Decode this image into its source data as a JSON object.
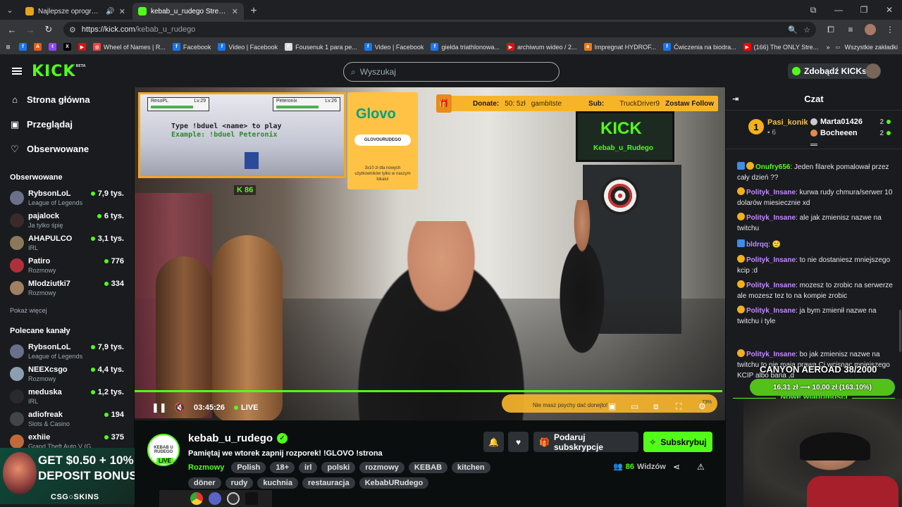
{
  "browser": {
    "tabs": [
      {
        "title": "Najlepsze oprogramowanie",
        "icon": "shield-icon",
        "color": "#e5a41b"
      },
      {
        "title": "kebab_u_rudego Stream - Watch",
        "icon": "kick-icon",
        "color": "#53fc18"
      }
    ],
    "url_host": "https://kick.com",
    "url_path": "/kebab_u_rudego",
    "bookmarks": [
      {
        "label": "Facebook",
        "color": "#1877f2",
        "glyph": "f"
      },
      {
        "label": "Video | Facebook",
        "color": "#1877f2",
        "glyph": "f"
      },
      {
        "label": "Fousenuk 1 para pe...",
        "color": "#ddd",
        "glyph": "F"
      },
      {
        "label": "Video | Facebook",
        "color": "#1877f2",
        "glyph": "f"
      },
      {
        "label": "giełda triathlonowa...",
        "color": "#1877f2",
        "glyph": "f"
      },
      {
        "label": "archiwum wideo / 2...",
        "color": "#d11",
        "glyph": "▶"
      },
      {
        "label": "Impregnat HYDROF...",
        "color": "#e87b17",
        "glyph": "a"
      },
      {
        "label": "Ćwiczenia na biodra...",
        "color": "#1877f2",
        "glyph": "f"
      },
      {
        "label": "(166) The ONLY Stre...",
        "color": "#f00",
        "glyph": "▶"
      }
    ],
    "wheel_bookmark": "Wheel of Names | R...",
    "all_bookmarks": "Wszystkie zakładki"
  },
  "header": {
    "logo": "KICK",
    "logo_sup": "BETA",
    "search_placeholder": "Wyszukaj",
    "get_kicks": "Zdobądź KICKs"
  },
  "sidebar": {
    "nav": [
      "Strona główna",
      "Przeglądaj",
      "Obserwowane"
    ],
    "followed_header": "Obserwowane",
    "followed": [
      {
        "name": "RybsonLoL",
        "category": "League of Legends",
        "viewers": "7,9 tys.",
        "color": "#6a6f8a"
      },
      {
        "name": "pajalock",
        "category": "Ja tylko śpię",
        "viewers": "6 tys.",
        "color": "#3a2a2a"
      },
      {
        "name": "AHAPULCO",
        "category": "IRL",
        "viewers": "3,1 tys.",
        "color": "#8a7a5a"
      },
      {
        "name": "Patiro",
        "category": "Rozmowy",
        "viewers": "776",
        "color": "#b0303a"
      },
      {
        "name": "Mlodziutki7",
        "category": "Rozmowy",
        "viewers": "334",
        "color": "#a08060"
      }
    ],
    "show_more": "Pokaż więcej",
    "recommended_header": "Polecane kanały",
    "recommended": [
      {
        "name": "RybsonLoL",
        "category": "League of Legends",
        "viewers": "7,9 tys.",
        "color": "#6a6f8a"
      },
      {
        "name": "NEEXcsgo",
        "category": "Rozmowy",
        "viewers": "4,4 tys.",
        "color": "#8aa0b0"
      },
      {
        "name": "meduska",
        "category": "IRL",
        "viewers": "1,2 tys.",
        "color": "#2a2a2a"
      },
      {
        "name": "adiofreak",
        "category": "Slots & Casino",
        "viewers": "194",
        "color": "#444"
      },
      {
        "name": "exhiie",
        "category": "Grand Theft Auto V (G...",
        "viewers": "375",
        "color": "#c06a3a"
      }
    ],
    "ad": {
      "line1": "GET $0.50 + 10%",
      "line2": "DEPOSIT BONUS",
      "brand": "CSG○SKINS"
    }
  },
  "video": {
    "game_p1": "ResoPL",
    "game_p1_lv": "Lv.29",
    "game_p2": "Peteronix",
    "game_p2_lv": "Lv.26",
    "game_line1": "Type !bduel <name> to play",
    "game_line2": "Example: !bduel Peteronix",
    "k_count": "86",
    "glovo": "Glovo",
    "glovo_code": "GLOVOURUDEGO",
    "glovo_promo": "3x10 zł dla nowych użytkowników tylko w naszym lokalu!",
    "donate_label": "Donate:",
    "donate_value": "50: 5zł",
    "donate_user": "gambitste",
    "sub_label": "Sub:",
    "sub_user": "TruckDriver9",
    "follow_label": "Zostaw Follow",
    "tv_text": "KICK",
    "tv_sub": "Kebab_u_Rudego",
    "time": "03:45:26",
    "live": "LIVE",
    "progress": 0.995,
    "overlay_msg": "Nie masz psychy dać donejto!",
    "overlay_pct": "73%"
  },
  "stream": {
    "name": "kebab_u_rudego",
    "avatar_text": "KEBAB U RUDEGO",
    "live_badge": "LIVE",
    "title": "Pamiętaj we wtorek zapnij rozporek! !GLOVO !strona",
    "category": "Rozmowy",
    "tags": [
      "Polish",
      "18+",
      "irl",
      "polski",
      "rozmowy",
      "KEBAB",
      "kitchen",
      "döner",
      "rudy",
      "kuchnia",
      "restauracja",
      "KebabURudego"
    ],
    "gift_sub": "Podaruj subskrypcje",
    "subscribe": "Subskrybuj",
    "viewers": "86",
    "viewers_label": "Widzów"
  },
  "chat": {
    "title": "Czat",
    "pinned_main": {
      "name": "Pasi_konik",
      "count": "6"
    },
    "pinned_rows": [
      {
        "name": "Marta01426",
        "count": "2",
        "color": "#ccc"
      },
      {
        "name": "Bocheeen",
        "count": "2",
        "color": "#e58a4a"
      }
    ],
    "messages": [
      {
        "user": "Onufry656",
        "style": "u-green",
        "badges": [
          "b-blue",
          "b-gold"
        ],
        "text": "Jeden filarek pomalował przez cały dzień ??"
      },
      {
        "user": "Polityk_Insane",
        "style": "u-purple",
        "badges": [
          "b-gold"
        ],
        "text": "kurwa rudy chmura/serwer 10 dolarów miesiecznie xd"
      },
      {
        "user": "Polityk_Insane",
        "style": "u-purple",
        "badges": [
          "b-gold"
        ],
        "text": "ale jak zmienisz nazwe na twitchu"
      },
      {
        "user": "bldrqq",
        "style": "u-violet",
        "badges": [
          "b-blue"
        ],
        "text": "🙂"
      },
      {
        "user": "Polityk_Insane",
        "style": "u-purple",
        "badges": [
          "b-gold"
        ],
        "text": "to nie dostaniesz mniejszego kcip :d"
      },
      {
        "user": "Polityk_Insane",
        "style": "u-purple",
        "badges": [
          "b-gold"
        ],
        "text": "mozesz to zrobic na serwerze ale mozesz tez to na kompie zrobic"
      },
      {
        "user": "Polityk_Insane",
        "style": "u-purple",
        "badges": [
          "b-gold"
        ],
        "text": "ja bym zmienił nazwe na twitchu i tyle"
      },
      {
        "user": "Polityk_Insane",
        "style": "u-purple",
        "badges": [
          "b-gold"
        ],
        "text": "bo jak zmienisz nazwe na twitchu to nie mają prawa Ci wcisnąc mniejszego KCIP albo bana ,d"
      }
    ],
    "new_messages": "Nowe wiadomości",
    "overlay_title": "CANYON AEROAD 38/2000",
    "overlay_price": "16,31 zł ⟶ 10,00 zł (163.10%)"
  }
}
